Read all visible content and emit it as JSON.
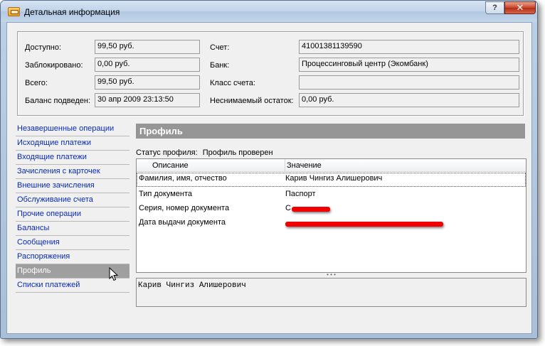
{
  "window": {
    "title": "Детальная информация",
    "help_label": "?",
    "close_label": "✕"
  },
  "info": {
    "available": {
      "label": "Доступно:",
      "value": "99,50 руб."
    },
    "blocked": {
      "label": "Заблокировано:",
      "value": "0,00 руб."
    },
    "total": {
      "label": "Всего:",
      "value": "99,50 руб."
    },
    "balance_date": {
      "label": "Баланс подведен:",
      "value": "30 апр 2009 23:13:50"
    },
    "account": {
      "label": "Счет:",
      "value": "41001381139590"
    },
    "bank": {
      "label": "Банк:",
      "value": "Процессинговый центр (Экомбанк)"
    },
    "account_class": {
      "label": "Класс счета:",
      "value": ""
    },
    "min_balance": {
      "label": "Неснимаемый остаток:",
      "value": "0,00 руб."
    }
  },
  "nav": {
    "items": [
      {
        "label": "Незавершенные операции"
      },
      {
        "label": "Исходящие платежи"
      },
      {
        "label": "Входящие платежи"
      },
      {
        "label": "Зачисления с карточек"
      },
      {
        "label": "Внешние зачисления"
      },
      {
        "label": "Обслуживание счета"
      },
      {
        "label": "Прочие операции"
      },
      {
        "label": "Балансы"
      },
      {
        "label": "Сообщения"
      },
      {
        "label": "Распоряжения"
      },
      {
        "label": "Профиль"
      },
      {
        "label": "Списки платежей"
      }
    ],
    "selected_index": 10
  },
  "profile": {
    "header": "Профиль",
    "status_label": "Статус профиля:",
    "status_value": "Профиль проверен",
    "columns": {
      "description": "Описание",
      "value": "Значение"
    },
    "rows": [
      {
        "description": "Фамилия, имя, отчество",
        "value": "Карив Чингиз Алишерович"
      },
      {
        "description": "Тип документа",
        "value": "Паспорт"
      },
      {
        "description": "Серия, номер документа",
        "value": "С"
      },
      {
        "description": "Дата выдачи документа",
        "value": ""
      }
    ],
    "splitter_label": "• • •",
    "memo_text": "Карив Чингиз Алишерович"
  },
  "colors": {
    "link": "#0a2bb0",
    "selected_bg": "#9f9f9f",
    "header_bg": "#969696",
    "redaction": "#f00000"
  }
}
